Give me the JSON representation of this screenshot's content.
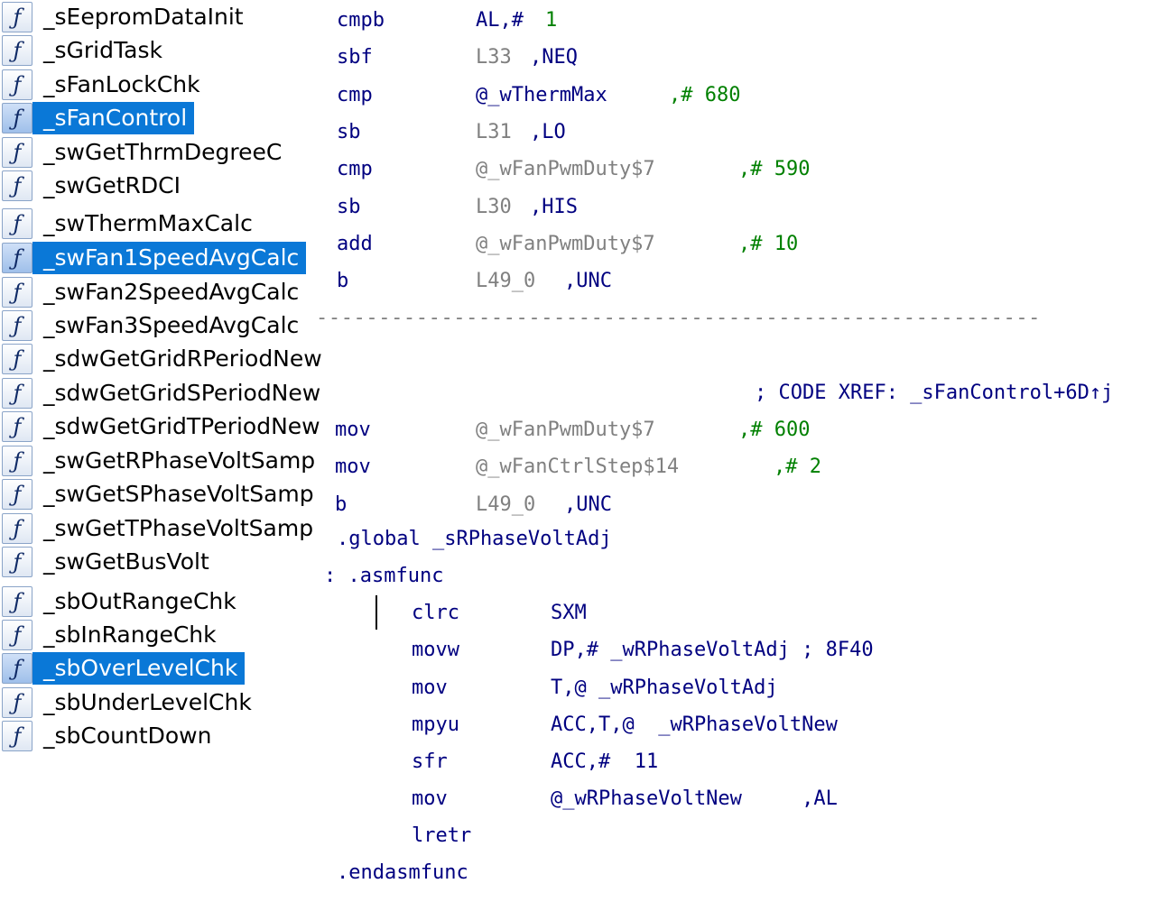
{
  "functions": [
    {
      "name": "_sEepromDataInit",
      "selected": false
    },
    {
      "name": "_sGridTask",
      "selected": false
    },
    {
      "name": "_sFanLockChk",
      "selected": false
    },
    {
      "name": "_sFanControl",
      "selected": true
    },
    {
      "name": "_swGetThrmDegreeC",
      "selected": false
    },
    {
      "name": "_swGetRDCI",
      "selected": false
    },
    {
      "name": "_swThermMaxCalc",
      "selected": false
    },
    {
      "name": "_swFan1SpeedAvgCalc",
      "selected": true
    },
    {
      "name": "_swFan2SpeedAvgCalc",
      "selected": false
    },
    {
      "name": "_swFan3SpeedAvgCalc",
      "selected": false
    },
    {
      "name": "_sdwGetGridRPeriodNew",
      "selected": false
    },
    {
      "name": "_sdwGetGridSPeriodNew",
      "selected": false
    },
    {
      "name": "_sdwGetGridTPeriodNew",
      "selected": false
    },
    {
      "name": "_swGetRPhaseVoltSamp",
      "selected": false
    },
    {
      "name": "_swGetSPhaseVoltSamp",
      "selected": false
    },
    {
      "name": "_swGetTPhaseVoltSamp",
      "selected": false
    },
    {
      "name": "_swGetBusVolt",
      "selected": false
    },
    {
      "name": "_sbOutRangeChk",
      "selected": false
    },
    {
      "name": "_sbInRangeChk",
      "selected": false
    },
    {
      "name": "_sbOverLevelChk",
      "selected": true
    },
    {
      "name": "_sbUnderLevelChk",
      "selected": false
    },
    {
      "name": "_sbCountDown",
      "selected": false
    }
  ],
  "function_icon": "function-f-icon",
  "code": {
    "lines": [
      {
        "mnemonic": "cmpb",
        "op1": "AL,#",
        "op1_style": "opn",
        "op2": "1",
        "op2_style": "num"
      },
      {
        "mnemonic": "sbf",
        "op1": "L33",
        "op1_style": "opg",
        "op2": ",NEQ",
        "op2_style": "opn"
      },
      {
        "mnemonic": "cmp",
        "op1": "@_wThermMax",
        "op1_style": "opn",
        "op2": ",# 680",
        "op2_style": "num"
      },
      {
        "mnemonic": "sb",
        "op1": "L31",
        "op1_style": "opg",
        "op2": ",LO",
        "op2_style": "opn"
      },
      {
        "mnemonic": "cmp",
        "op1": "@_wFanPwmDuty$7",
        "op1_style": "opg",
        "op2": ",# 590",
        "op2_style": "num"
      },
      {
        "mnemonic": "sb",
        "op1": "L30",
        "op1_style": "opg",
        "op2": ",HIS",
        "op2_style": "opn"
      },
      {
        "mnemonic": "add",
        "op1": "@_wFanPwmDuty$7",
        "op1_style": "opg",
        "op2": ",# 10",
        "op2_style": "num"
      },
      {
        "mnemonic": "b",
        "op1": "L49_0",
        "op1_style": "opg",
        "op2": ",UNC",
        "op2_style": "opn"
      }
    ],
    "separator": "----------------------------------------------------------",
    "xref": "; CODE XREF: _sFanControl+6D↑j",
    "lines2": [
      {
        "mnemonic": "mov",
        "op1": "@_wFanPwmDuty$7",
        "op1_style": "opg",
        "op2": ",# 600",
        "op2_style": "num"
      },
      {
        "mnemonic": "mov",
        "op1": "@_wFanCtrlStep$14",
        "op1_style": "opg",
        "op2": ",# 2",
        "op2_style": "num"
      },
      {
        "mnemonic": "b",
        "op1": "L49_0",
        "op1_style": "opg",
        "op2": ",UNC",
        "op2_style": "opn"
      }
    ],
    "global_directive": ".global _sRPhaseVoltAdj",
    "asmfunc_directive": ": .asmfunc",
    "asm_lines": [
      {
        "mnemonic": "clrc",
        "operand": "SXM"
      },
      {
        "mnemonic": "movw",
        "operand": "DP,# _wRPhaseVoltAdj ; 8F40"
      },
      {
        "mnemonic": "mov",
        "operand": "T,@ _wRPhaseVoltAdj"
      },
      {
        "mnemonic": "mpyu",
        "operand": "ACC,T,@  _wRPhaseVoltNew"
      },
      {
        "mnemonic": "sfr",
        "operand": "ACC,#  11"
      },
      {
        "mnemonic": "mov",
        "operand": "@_wRPhaseVoltNew     ,AL"
      },
      {
        "mnemonic": "lretr",
        "operand": ""
      }
    ],
    "endasmfunc_directive": ".endasmfunc"
  },
  "colors": {
    "selection": "#0a78d7",
    "mnemonic": "#000080",
    "gray_operand": "#808080",
    "number": "#008000"
  }
}
